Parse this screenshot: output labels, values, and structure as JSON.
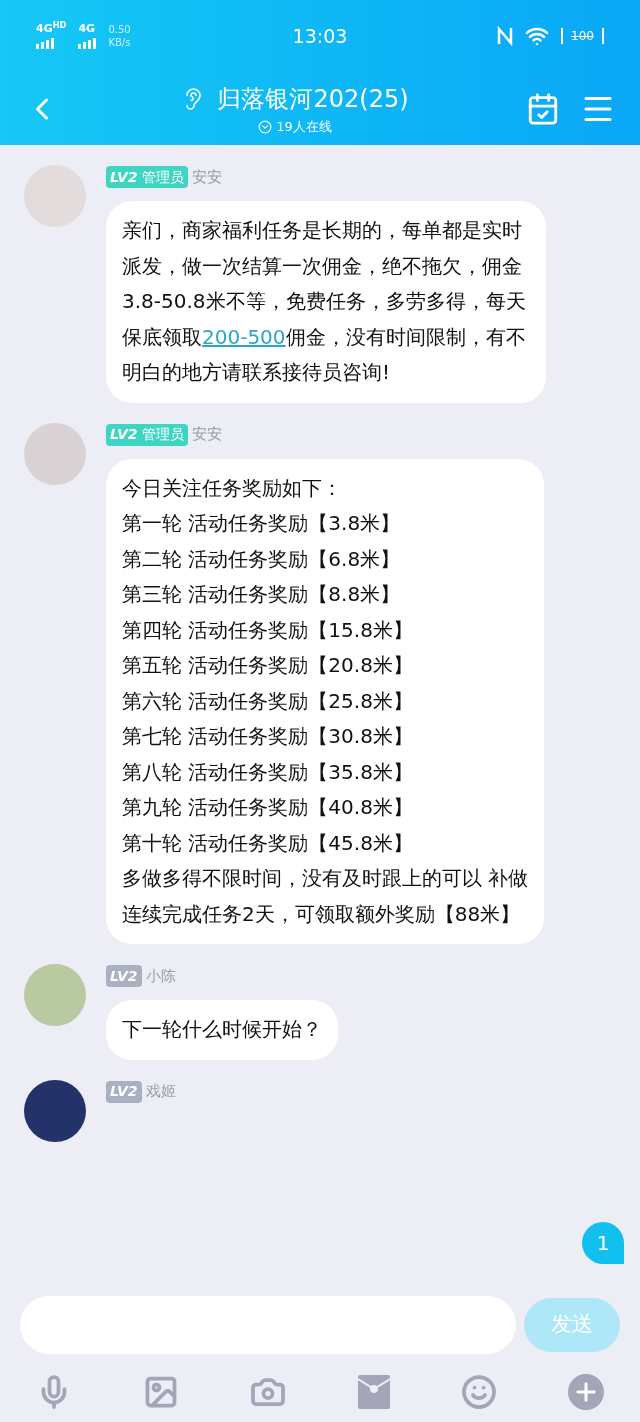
{
  "status_bar": {
    "network_1": "4G",
    "network_1_sup": "HD",
    "network_2": "4G",
    "speed_value": "0.50",
    "speed_unit": "KB/s",
    "time": "13:03",
    "battery": "100"
  },
  "header": {
    "title": "归落银河202(25)",
    "online": "19人在线"
  },
  "messages": [
    {
      "kind": "admin",
      "level": "LV2",
      "role": "管理员",
      "sender": "安安",
      "paragraphs": [
        [
          {
            "kind": "text",
            "text": "亲们，商家福利任务是长期的，每单都是实时派发，做一次结算一次佣金，绝不拖欠，佣金3.8-50.8米不等，免费任务，多劳多得，每天保底领取"
          },
          {
            "kind": "link",
            "text": "200-500"
          },
          {
            "kind": "text",
            "text": "佣金，没有时间限制，有不明白的地方请联系接待员咨询!"
          }
        ]
      ]
    },
    {
      "kind": "admin",
      "level": "LV2",
      "role": "管理员",
      "sender": "安安",
      "paragraphs": [
        [
          {
            "kind": "text",
            "text": "今日关注任务奖励如下："
          }
        ],
        [
          {
            "kind": "text",
            "text": "第一轮 活动任务奖励【3.8米】"
          }
        ],
        [
          {
            "kind": "text",
            "text": "第二轮 活动任务奖励【6.8米】"
          }
        ],
        [
          {
            "kind": "text",
            "text": "第三轮 活动任务奖励【8.8米】"
          }
        ],
        [
          {
            "kind": "text",
            "text": "第四轮 活动任务奖励【15.8米】"
          }
        ],
        [
          {
            "kind": "text",
            "text": "第五轮 活动任务奖励【20.8米】"
          }
        ],
        [
          {
            "kind": "text",
            "text": "第六轮 活动任务奖励【25.8米】"
          }
        ],
        [
          {
            "kind": "text",
            "text": "第七轮 活动任务奖励【30.8米】"
          }
        ],
        [
          {
            "kind": "text",
            "text": "第八轮 活动任务奖励【35.8米】"
          }
        ],
        [
          {
            "kind": "text",
            "text": "第九轮 活动任务奖励【40.8米】"
          }
        ],
        [
          {
            "kind": "text",
            "text": "第十轮 活动任务奖励【45.8米】"
          }
        ],
        [
          {
            "kind": "text",
            "text": "多做多得不限时间，没有及时跟上的可以 补做"
          }
        ],
        [
          {
            "kind": "text",
            "text": "连续完成任务2天，可领取额外奖励【88米】"
          }
        ]
      ]
    },
    {
      "kind": "member",
      "level": "LV2",
      "sender": "小陈",
      "paragraphs": [
        [
          {
            "kind": "text",
            "text": "下一轮什么时候开始？"
          }
        ]
      ]
    },
    {
      "kind": "member",
      "level": "LV2",
      "sender": "戏姬"
    }
  ],
  "unread_count": "1",
  "composer": {
    "send": "发送"
  }
}
